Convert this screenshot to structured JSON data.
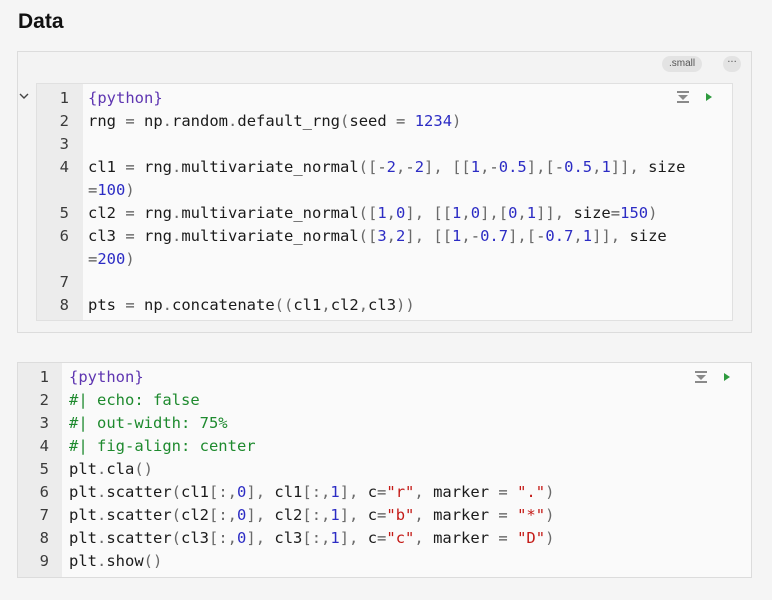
{
  "section": {
    "title": "Data"
  },
  "cell1": {
    "badge": ".small",
    "more": "···",
    "lines": [
      {
        "n": "1",
        "segs": [
          [
            "dir",
            "{python}"
          ]
        ]
      },
      {
        "n": "2",
        "segs": [
          [
            "t",
            "rng "
          ],
          [
            "op",
            "="
          ],
          [
            "t",
            " np"
          ],
          [
            "p",
            "."
          ],
          [
            "t",
            "random"
          ],
          [
            "p",
            "."
          ],
          [
            "t",
            "default_rng"
          ],
          [
            "p",
            "("
          ],
          [
            "t",
            "seed "
          ],
          [
            "op",
            "="
          ],
          [
            "t",
            " "
          ],
          [
            "num",
            "1234"
          ],
          [
            "p",
            ")"
          ]
        ]
      },
      {
        "n": "3",
        "segs": []
      },
      {
        "n": "4",
        "segs": [
          [
            "t",
            "cl1 "
          ],
          [
            "op",
            "="
          ],
          [
            "t",
            " rng"
          ],
          [
            "p",
            "."
          ],
          [
            "t",
            "multivariate_normal"
          ],
          [
            "p",
            "(["
          ],
          [
            "op",
            "-"
          ],
          [
            "num",
            "2"
          ],
          [
            "p",
            ","
          ],
          [
            "op",
            "-"
          ],
          [
            "num",
            "2"
          ],
          [
            "p",
            "],"
          ],
          [
            "t",
            " "
          ],
          [
            "p",
            "[["
          ],
          [
            "num",
            "1"
          ],
          [
            "p",
            ","
          ],
          [
            "op",
            "-"
          ],
          [
            "num",
            "0.5"
          ],
          [
            "p",
            "],["
          ],
          [
            "op",
            "-"
          ],
          [
            "num",
            "0.5"
          ],
          [
            "p",
            ","
          ],
          [
            "num",
            "1"
          ],
          [
            "p",
            "]],"
          ],
          [
            "t",
            " size"
          ]
        ]
      },
      {
        "n": "",
        "segs": [
          [
            "op",
            "="
          ],
          [
            "num",
            "100"
          ],
          [
            "p",
            ")"
          ]
        ]
      },
      {
        "n": "5",
        "segs": [
          [
            "t",
            "cl2 "
          ],
          [
            "op",
            "="
          ],
          [
            "t",
            " rng"
          ],
          [
            "p",
            "."
          ],
          [
            "t",
            "multivariate_normal"
          ],
          [
            "p",
            "(["
          ],
          [
            "num",
            "1"
          ],
          [
            "p",
            ","
          ],
          [
            "num",
            "0"
          ],
          [
            "p",
            "],"
          ],
          [
            "t",
            " "
          ],
          [
            "p",
            "[["
          ],
          [
            "num",
            "1"
          ],
          [
            "p",
            ","
          ],
          [
            "num",
            "0"
          ],
          [
            "p",
            "],["
          ],
          [
            "num",
            "0"
          ],
          [
            "p",
            ","
          ],
          [
            "num",
            "1"
          ],
          [
            "p",
            "]],"
          ],
          [
            "t",
            " size"
          ],
          [
            "op",
            "="
          ],
          [
            "num",
            "150"
          ],
          [
            "p",
            ")"
          ]
        ]
      },
      {
        "n": "6",
        "segs": [
          [
            "t",
            "cl3 "
          ],
          [
            "op",
            "="
          ],
          [
            "t",
            " rng"
          ],
          [
            "p",
            "."
          ],
          [
            "t",
            "multivariate_normal"
          ],
          [
            "p",
            "(["
          ],
          [
            "num",
            "3"
          ],
          [
            "p",
            ","
          ],
          [
            "num",
            "2"
          ],
          [
            "p",
            "],"
          ],
          [
            "t",
            " "
          ],
          [
            "p",
            "[["
          ],
          [
            "num",
            "1"
          ],
          [
            "p",
            ","
          ],
          [
            "op",
            "-"
          ],
          [
            "num",
            "0.7"
          ],
          [
            "p",
            "],["
          ],
          [
            "op",
            "-"
          ],
          [
            "num",
            "0.7"
          ],
          [
            "p",
            ","
          ],
          [
            "num",
            "1"
          ],
          [
            "p",
            "]],"
          ],
          [
            "t",
            " size"
          ]
        ]
      },
      {
        "n": "",
        "segs": [
          [
            "op",
            "="
          ],
          [
            "num",
            "200"
          ],
          [
            "p",
            ")"
          ]
        ]
      },
      {
        "n": "7",
        "segs": []
      },
      {
        "n": "8",
        "segs": [
          [
            "t",
            "pts "
          ],
          [
            "op",
            "="
          ],
          [
            "t",
            " np"
          ],
          [
            "p",
            "."
          ],
          [
            "t",
            "concatenate"
          ],
          [
            "p",
            "(("
          ],
          [
            "t",
            "cl1"
          ],
          [
            "p",
            ","
          ],
          [
            "t",
            "cl2"
          ],
          [
            "p",
            ","
          ],
          [
            "t",
            "cl3"
          ],
          [
            "p",
            "))"
          ]
        ]
      }
    ]
  },
  "cell2": {
    "lines": [
      {
        "n": "1",
        "segs": [
          [
            "dir",
            "{python}"
          ]
        ]
      },
      {
        "n": "2",
        "segs": [
          [
            "cm",
            "#| echo: false"
          ]
        ]
      },
      {
        "n": "3",
        "segs": [
          [
            "cm",
            "#| out-width: 75%"
          ]
        ]
      },
      {
        "n": "4",
        "segs": [
          [
            "cm",
            "#| fig-align: center"
          ]
        ]
      },
      {
        "n": "5",
        "segs": [
          [
            "t",
            "plt"
          ],
          [
            "p",
            "."
          ],
          [
            "t",
            "cla"
          ],
          [
            "p",
            "()"
          ]
        ]
      },
      {
        "n": "6",
        "segs": [
          [
            "t",
            "plt"
          ],
          [
            "p",
            "."
          ],
          [
            "t",
            "scatter"
          ],
          [
            "p",
            "("
          ],
          [
            "t",
            "cl1"
          ],
          [
            "p",
            "[:,"
          ],
          [
            "num",
            "0"
          ],
          [
            "p",
            "],"
          ],
          [
            "t",
            " cl1"
          ],
          [
            "p",
            "[:,"
          ],
          [
            "num",
            "1"
          ],
          [
            "p",
            "],"
          ],
          [
            "t",
            " c"
          ],
          [
            "op",
            "="
          ],
          [
            "str",
            "\"r\""
          ],
          [
            "p",
            ","
          ],
          [
            "t",
            " marker "
          ],
          [
            "op",
            "="
          ],
          [
            "t",
            " "
          ],
          [
            "str",
            "\".\""
          ],
          [
            "p",
            ")"
          ]
        ]
      },
      {
        "n": "7",
        "segs": [
          [
            "t",
            "plt"
          ],
          [
            "p",
            "."
          ],
          [
            "t",
            "scatter"
          ],
          [
            "p",
            "("
          ],
          [
            "t",
            "cl2"
          ],
          [
            "p",
            "[:,"
          ],
          [
            "num",
            "0"
          ],
          [
            "p",
            "],"
          ],
          [
            "t",
            " cl2"
          ],
          [
            "p",
            "[:,"
          ],
          [
            "num",
            "1"
          ],
          [
            "p",
            "],"
          ],
          [
            "t",
            " c"
          ],
          [
            "op",
            "="
          ],
          [
            "str",
            "\"b\""
          ],
          [
            "p",
            ","
          ],
          [
            "t",
            " marker "
          ],
          [
            "op",
            "="
          ],
          [
            "t",
            " "
          ],
          [
            "str",
            "\"*\""
          ],
          [
            "p",
            ")"
          ]
        ]
      },
      {
        "n": "8",
        "segs": [
          [
            "t",
            "plt"
          ],
          [
            "p",
            "."
          ],
          [
            "t",
            "scatter"
          ],
          [
            "p",
            "("
          ],
          [
            "t",
            "cl3"
          ],
          [
            "p",
            "[:,"
          ],
          [
            "num",
            "0"
          ],
          [
            "p",
            "],"
          ],
          [
            "t",
            " cl3"
          ],
          [
            "p",
            "[:,"
          ],
          [
            "num",
            "1"
          ],
          [
            "p",
            "],"
          ],
          [
            "t",
            " c"
          ],
          [
            "op",
            "="
          ],
          [
            "str",
            "\"c\""
          ],
          [
            "p",
            ","
          ],
          [
            "t",
            " marker "
          ],
          [
            "op",
            "="
          ],
          [
            "t",
            " "
          ],
          [
            "str",
            "\"D\""
          ],
          [
            "p",
            ")"
          ]
        ]
      },
      {
        "n": "9",
        "segs": [
          [
            "t",
            "plt"
          ],
          [
            "p",
            "."
          ],
          [
            "t",
            "show"
          ],
          [
            "p",
            "()"
          ]
        ]
      }
    ]
  },
  "colors": {
    "run_icon": "#2e9a3e",
    "run_above_icon": "#8a8a8a",
    "directive": "#5e35b1",
    "number": "#2c2cc4",
    "string": "#c41a16",
    "comment": "#1e8a2e"
  },
  "icons": {
    "collapse": "chevron-down-icon",
    "run_above": "run-above-icon",
    "run_cell": "play-icon"
  }
}
